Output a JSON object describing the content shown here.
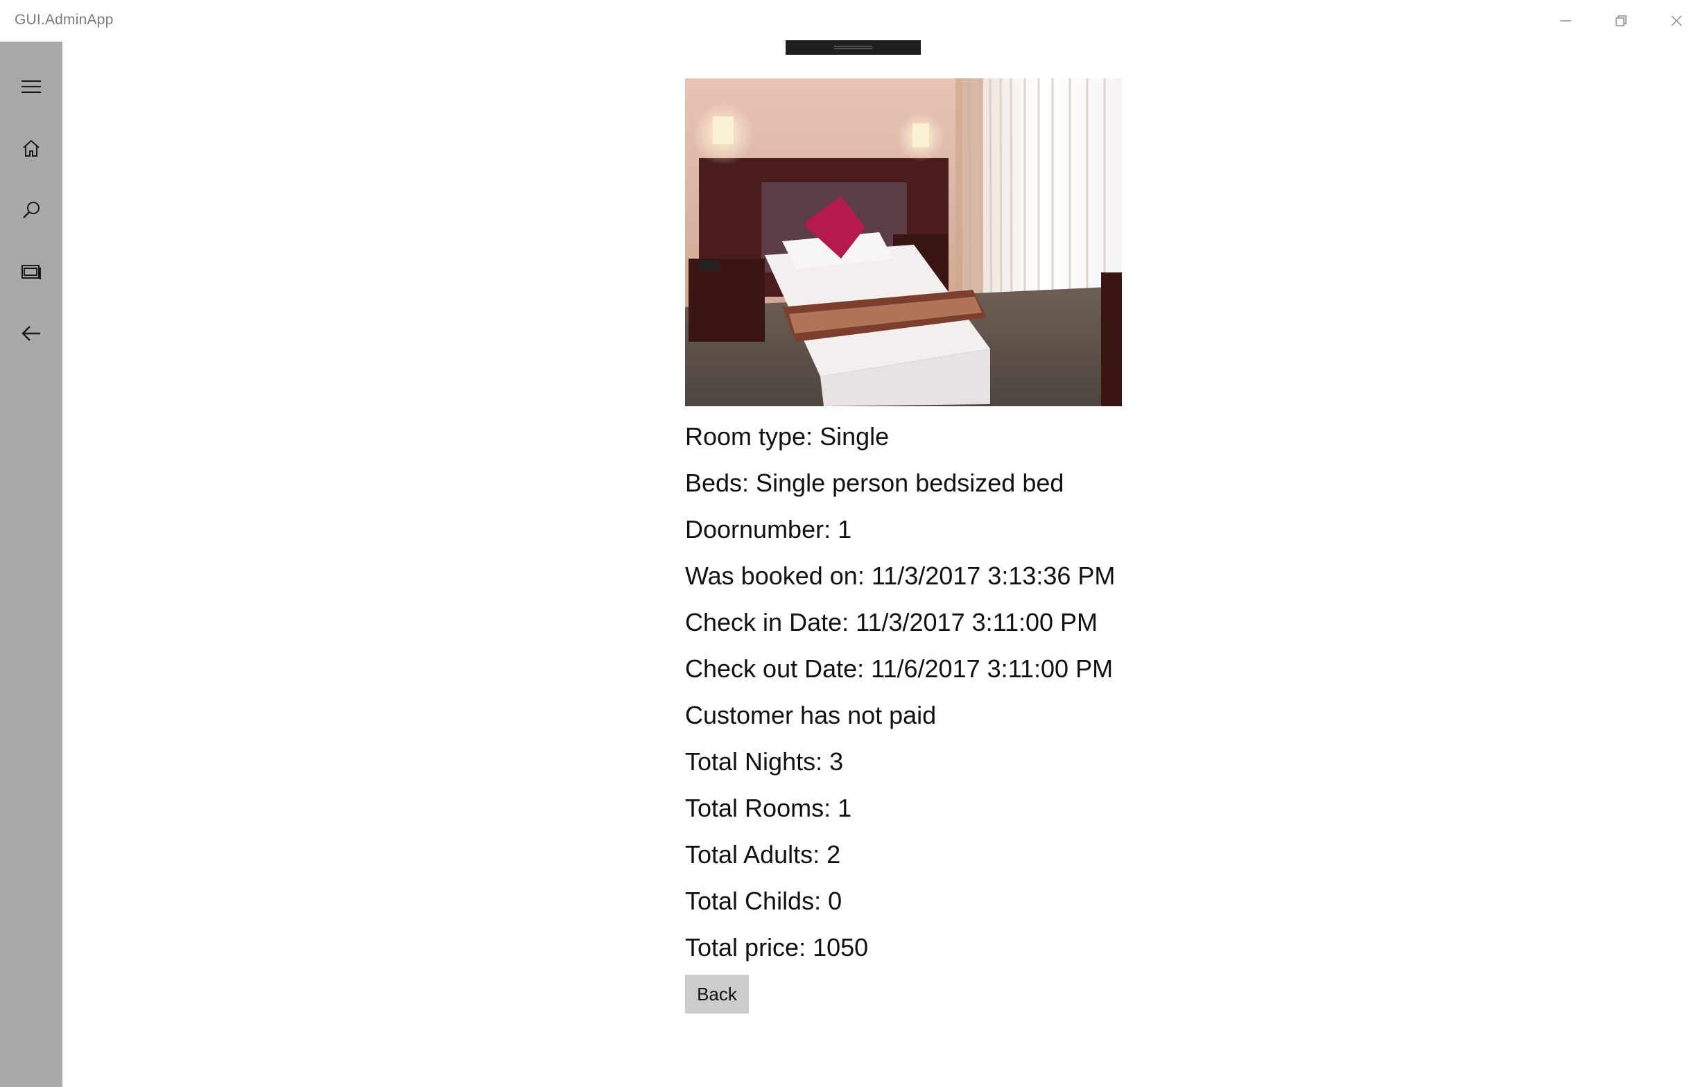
{
  "window": {
    "title": "GUI.AdminApp",
    "controls": {
      "minimize_icon": "minimize-icon",
      "maximize_icon": "restore-icon",
      "close_icon": "close-icon"
    }
  },
  "nav": {
    "items": [
      {
        "icon": "hamburger-menu-icon"
      },
      {
        "icon": "home-icon"
      },
      {
        "icon": "search-icon"
      },
      {
        "icon": "bookings-icon"
      },
      {
        "icon": "back-arrow-icon"
      }
    ],
    "background": "#a9a9a9"
  },
  "booking": {
    "room_type": "Room type: Single",
    "beds": "Beds: Single person bedsized bed",
    "door_number": "Doornumber: 1",
    "booked_on": "Was booked on: 11/3/2017 3:13:36 PM",
    "check_in": "Check in Date: 11/3/2017 3:11:00 PM",
    "check_out": "Check out Date: 11/6/2017 3:11:00 PM",
    "payment_status": "Customer has not paid",
    "total_nights": "Total Nights: 3",
    "total_rooms": "Total Rooms: 1",
    "total_adults": "Total Adults: 2",
    "total_childs": "Total Childs: 0",
    "total_price": "Total price: 1050"
  },
  "actions": {
    "back_label": "Back"
  }
}
